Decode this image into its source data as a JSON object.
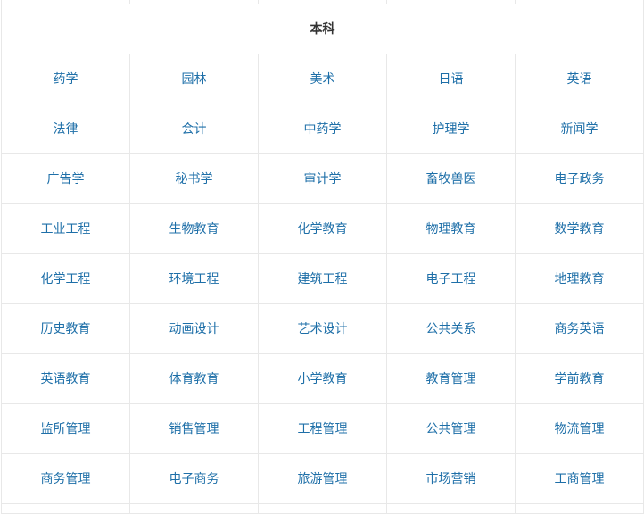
{
  "table": {
    "header": "本科",
    "rows": [
      [
        "药学",
        "园林",
        "美术",
        "日语",
        "英语"
      ],
      [
        "法律",
        "会计",
        "中药学",
        "护理学",
        "新闻学"
      ],
      [
        "广告学",
        "秘书学",
        "审计学",
        "畜牧兽医",
        "电子政务"
      ],
      [
        "工业工程",
        "生物教育",
        "化学教育",
        "物理教育",
        "数学教育"
      ],
      [
        "化学工程",
        "环境工程",
        "建筑工程",
        "电子工程",
        "地理教育"
      ],
      [
        "历史教育",
        "动画设计",
        "艺术设计",
        "公共关系",
        "商务英语"
      ],
      [
        "英语教育",
        "体育教育",
        "小学教育",
        "教育管理",
        "学前教育"
      ],
      [
        "监所管理",
        "销售管理",
        "工程管理",
        "公共管理",
        "物流管理"
      ],
      [
        "商务管理",
        "电子商务",
        "旅游管理",
        "市场营销",
        "工商管理"
      ]
    ]
  },
  "colors": {
    "link": "#1e6fa8",
    "header_text": "#333333",
    "border": "#e8e8e8"
  }
}
